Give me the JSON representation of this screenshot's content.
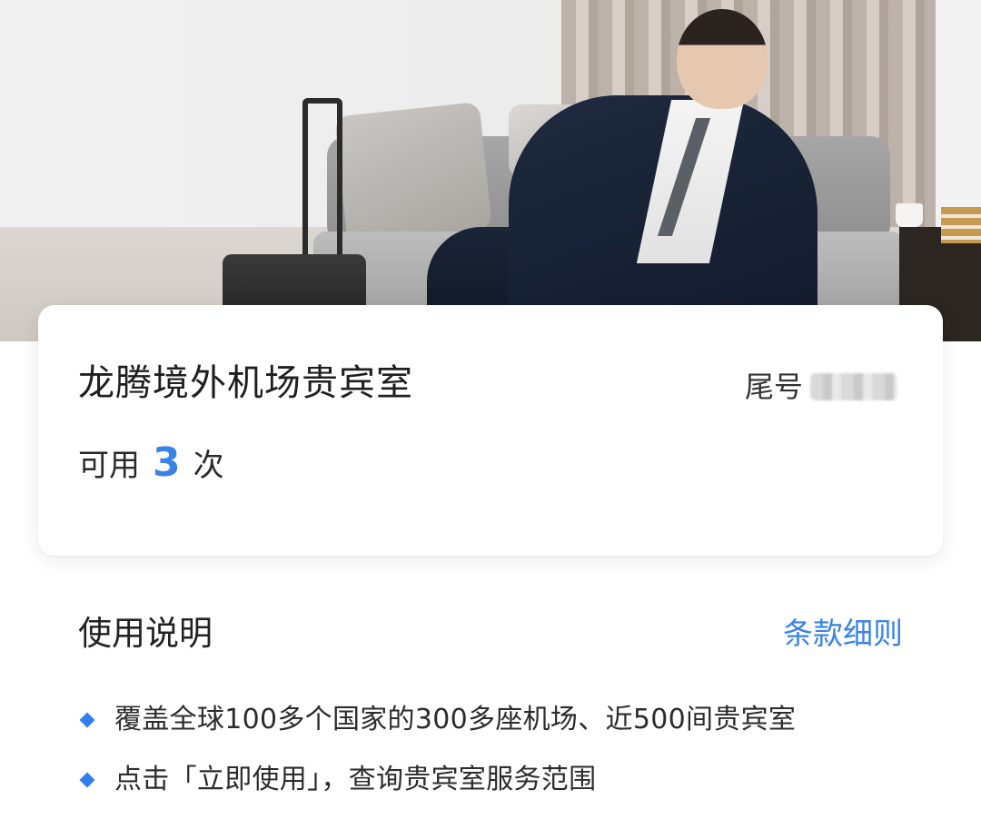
{
  "card": {
    "title": "龙腾境外机场贵宾室",
    "tail_label": "尾号",
    "available_prefix": "可用",
    "available_count": "3",
    "available_suffix": "次"
  },
  "instructions": {
    "title": "使用说明",
    "terms_link": "条款细则",
    "items": [
      "覆盖全球100多个国家的300多座机场、近500间贵宾室",
      "点击「立即使用」，查询贵宾室服务范围"
    ]
  },
  "colors": {
    "accent": "#3A83E6",
    "bullet": "#2F7FF0"
  }
}
